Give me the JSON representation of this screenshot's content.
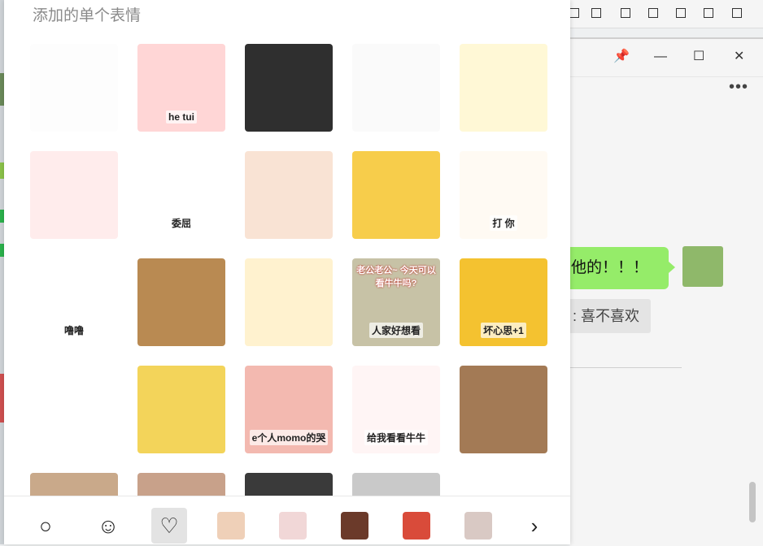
{
  "panel": {
    "title": "添加的单个表情"
  },
  "stickers": [
    {
      "name": "sticker-cat-thinking",
      "color": "#fdfdfd"
    },
    {
      "name": "sticker-strawberry",
      "color": "#ffd6d6",
      "caption": "he tui"
    },
    {
      "name": "sticker-yellow-cat-mask",
      "color": "#2f2f2f"
    },
    {
      "name": "sticker-tiny-face",
      "color": "#fafafa"
    },
    {
      "name": "sticker-hamster-sparkle",
      "color": "#fff8d6"
    },
    {
      "name": "sticker-pink-bunny",
      "color": "#ffecec"
    },
    {
      "name": "sticker-weiqu",
      "color": "#ffffff",
      "caption": "委屈"
    },
    {
      "name": "sticker-pat-head",
      "color": "#f9e3d4"
    },
    {
      "name": "sticker-yellow-face",
      "color": "#f7cd4b"
    },
    {
      "name": "sticker-cats-hit",
      "color": "#fffaf3",
      "caption": "打 你"
    },
    {
      "name": "sticker-lulu-cat",
      "color": "#ffffff",
      "caption": "噜噜"
    },
    {
      "name": "sticker-teddy-bear",
      "color": "#b98a52"
    },
    {
      "name": "sticker-shy-bear",
      "color": "#fff2cf"
    },
    {
      "name": "sticker-cat-question",
      "color": "#c7c2a6",
      "top": "老公老公~",
      "sub": "今天可以看牛牛吗?",
      "caption": "人家好想看"
    },
    {
      "name": "sticker-bad-idea",
      "color": "#f4c230",
      "caption": "坏心思+1"
    },
    {
      "name": "sticker-fingers",
      "color": "#ffffff"
    },
    {
      "name": "sticker-yellow-pout",
      "color": "#f3d45a"
    },
    {
      "name": "sticker-momo-cry",
      "color": "#f3b9b0",
      "caption": "e个人momo的哭"
    },
    {
      "name": "sticker-niuniu",
      "color": "#fff5f5",
      "caption": "给我看看牛牛"
    },
    {
      "name": "sticker-crying-kitten",
      "color": "#a37a55"
    },
    {
      "name": "sticker-row5-1",
      "color": "#c9a98a"
    },
    {
      "name": "sticker-row5-2",
      "color": "#c8a18a"
    },
    {
      "name": "sticker-row5-3",
      "color": "#3a3a3a"
    },
    {
      "name": "sticker-row5-4",
      "color": "#c9c9c9"
    },
    {
      "name": "sticker-row5-5",
      "color": "#ffffff"
    }
  ],
  "bottom_bar": {
    "items": [
      {
        "name": "search-icon",
        "glyph": "○"
      },
      {
        "name": "smiley-icon",
        "glyph": "☺"
      },
      {
        "name": "heart-icon",
        "glyph": "♡",
        "active": true
      },
      {
        "name": "pack-1",
        "thumb": "#efd0b8"
      },
      {
        "name": "pack-2",
        "thumb": "#f1d7d7"
      },
      {
        "name": "pack-3",
        "thumb": "#6b3a2a"
      },
      {
        "name": "pack-4",
        "thumb": "#d94b3a"
      },
      {
        "name": "pack-5",
        "thumb": "#d9c9c4"
      },
      {
        "name": "next-icon",
        "glyph": "›"
      }
    ]
  },
  "chat": {
    "message_text": "他的！！！",
    "quote_text": ": 喜不喜欢",
    "win_pin": "📌",
    "win_min": "—",
    "win_max": "☐",
    "win_close": "✕",
    "more": "•••"
  }
}
